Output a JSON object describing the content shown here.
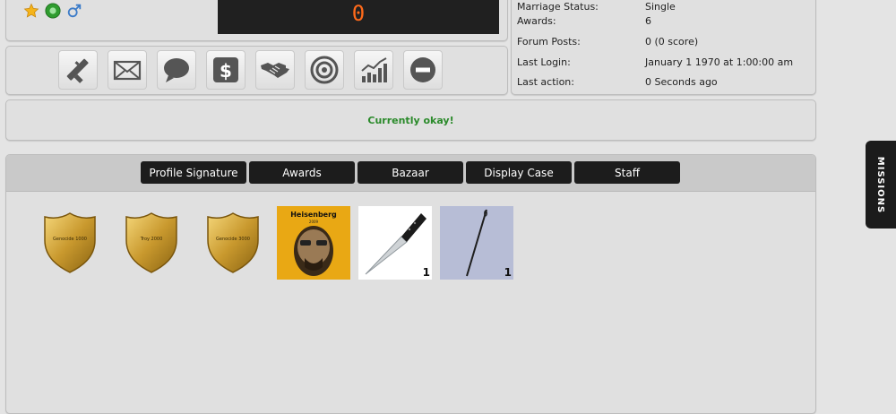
{
  "counter": "0",
  "info_rows": [
    {
      "label": "Marriage Status:",
      "value": "Single"
    },
    {
      "label": "Awards:",
      "value": "6"
    },
    {
      "label": "Forum Posts:",
      "value": "0 (0 score)"
    },
    {
      "label": "Last Login:",
      "value": "January 1 1970 at 1:00:00 am"
    },
    {
      "label": "Last action:",
      "value": "0 Seconds ago"
    }
  ],
  "status_message": "Currently okay!",
  "tabs": [
    "Profile Signature",
    "Awards",
    "Bazaar",
    "Display Case",
    "Staff"
  ],
  "display_items": [
    {
      "name": "Heisenberg",
      "subtitle": "2009",
      "qty": ""
    },
    {
      "name": "knife",
      "qty": "1"
    },
    {
      "name": "needle",
      "qty": "1"
    }
  ],
  "medals": [
    {
      "text": "Genocide 1000"
    },
    {
      "text": "Troy 2000"
    },
    {
      "text": "Genocide 3000"
    }
  ],
  "missions_label": "MISSIONS",
  "colors": {
    "ok_green": "#2a8a2a",
    "counter_orange": "#ff6a1a",
    "tab_bg": "#1c1c1c"
  }
}
